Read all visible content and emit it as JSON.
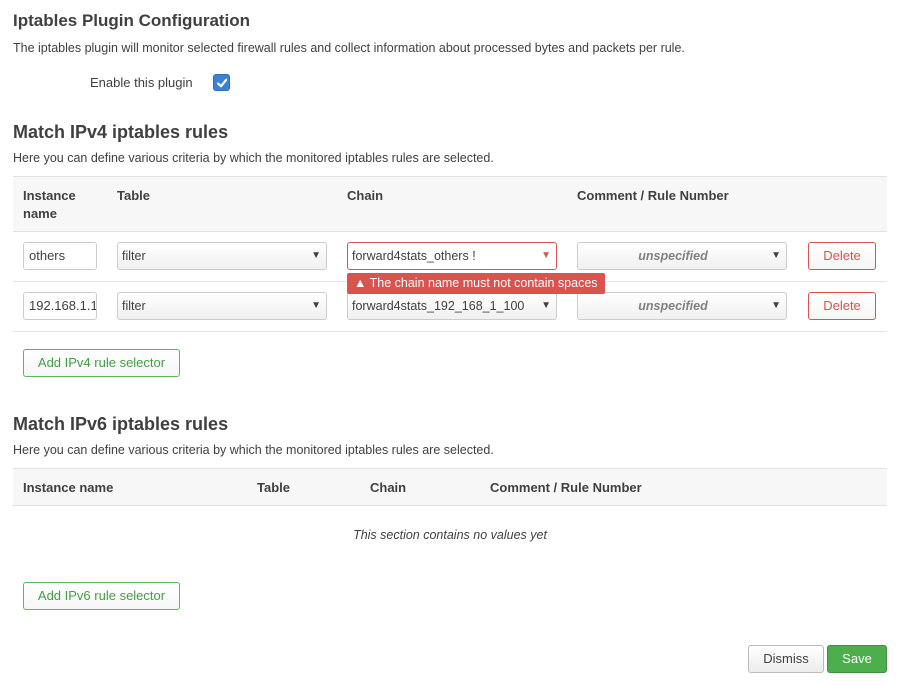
{
  "dialog": {
    "title": "Iptables Plugin Configuration",
    "description": "The iptables plugin will monitor selected firewall rules and collect information about processed bytes and packets per rule.",
    "enable_label": "Enable this plugin",
    "enable_checked": true
  },
  "ipv4": {
    "title": "Match IPv4 iptables rules",
    "description": "Here you can define various criteria by which the monitored iptables rules are selected.",
    "headers": {
      "instance_line1": "Instance",
      "instance_line2": "name",
      "table": "Table",
      "chain": "Chain",
      "comment": "Comment / Rule Number"
    },
    "rows": [
      {
        "instance": "others",
        "table": "filter",
        "chain": "forward4stats_others !",
        "comment": "unspecified",
        "delete": "Delete"
      },
      {
        "instance": "192.168.1.1",
        "table": "filter",
        "chain": "forward4stats_192_168_1_100",
        "comment": "unspecified",
        "delete": "Delete"
      }
    ],
    "error": "The chain name must not contain spaces",
    "add_button": "Add IPv4 rule selector"
  },
  "ipv6": {
    "title": "Match IPv6 iptables rules",
    "description": "Here you can define various criteria by which the monitored iptables rules are selected.",
    "headers": {
      "instance": "Instance name",
      "table": "Table",
      "chain": "Chain",
      "comment": "Comment / Rule Number"
    },
    "empty_message": "This section contains no values yet",
    "add_button": "Add IPv6 rule selector"
  },
  "footer": {
    "dismiss": "Dismiss",
    "save": "Save"
  },
  "icons": {
    "checkbox": "check-icon",
    "select_arrow": "caret-down-icon",
    "warning": "warning-triangle-icon"
  },
  "colors": {
    "accent": "#3b82d6",
    "danger": "#d9534f",
    "success": "#5cb85c",
    "save": "#4cae4c"
  }
}
